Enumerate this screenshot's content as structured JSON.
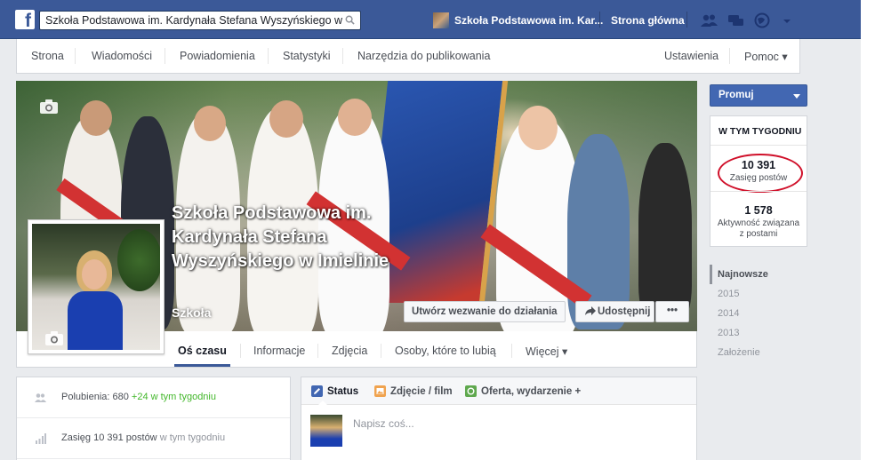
{
  "topbar": {
    "search_value": "Szkoła Podstawowa im. Kardynała Stefana Wyszyńskiego w",
    "page_name": "Szkoła Podstawowa im. Kar...",
    "home": "Strona główna"
  },
  "page_nav": {
    "items": [
      "Strona",
      "Wiadomości",
      "Powiadomienia",
      "Statystyki",
      "Narzędzia do publikowania"
    ],
    "settings": "Ustawienia",
    "help": "Pomoc ▾"
  },
  "cover": {
    "title": "Szkoła Podstawowa im. Kardynała Stefana Wyszyńskiego w Imielinie",
    "category": "Szkoła",
    "cta_button": "Utwórz wezwanie do działania",
    "share_button": "Udostępnij",
    "more_button": "•••"
  },
  "timeline_nav": {
    "items": [
      "Oś czasu",
      "Informacje",
      "Zdjęcia",
      "Osoby, które to lubią",
      "Więcej ▾"
    ]
  },
  "left": {
    "likes_prefix": "Polubienia: 680",
    "likes_delta": "+24 w tym tygodniu",
    "reach_prefix": "Zasięg 10 391 postów",
    "reach_suffix": "w tym tygodniu"
  },
  "composer": {
    "tabs": [
      "Status",
      "Zdjęcie / film",
      "Oferta, wydarzenie +"
    ],
    "placeholder": "Napisz coś..."
  },
  "right": {
    "promote": "Promuj",
    "week_title": "W TYM TYGODNIU",
    "reach_value": "10 391",
    "reach_label": "Zasięg postów",
    "engagement_value": "1 578",
    "engagement_label": "Aktywność związana z postami",
    "years": [
      "Najnowsze",
      "2015",
      "2014",
      "2013",
      "Założenie"
    ]
  },
  "colors": {
    "brand_blue": "#3b5998",
    "promote_blue": "#4267b2",
    "green_delta": "#42b72a",
    "annotation_red": "#d0102a"
  }
}
